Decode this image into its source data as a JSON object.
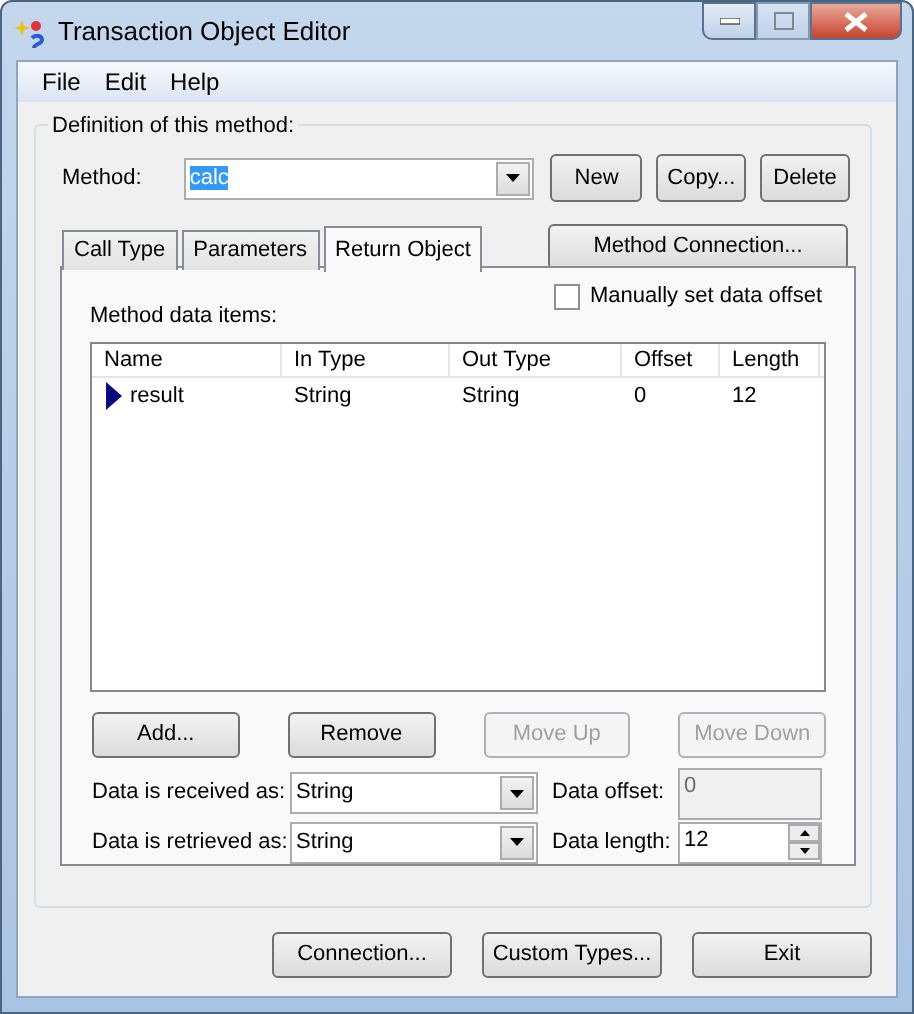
{
  "window": {
    "title": "Transaction Object Editor"
  },
  "menu": [
    {
      "label": "File"
    },
    {
      "label": "Edit"
    },
    {
      "label": "Help"
    }
  ],
  "definition": {
    "title": "Definition of this method:",
    "method": {
      "label": "Method:",
      "value": "calc"
    },
    "buttons": [
      {
        "label": "New",
        "disabled": false
      },
      {
        "label": "Copy...",
        "disabled": false
      },
      {
        "label": "Delete",
        "disabled": false
      }
    ],
    "tabs": [
      {
        "label": "Call Type",
        "selected": false
      },
      {
        "label": "Parameters",
        "selected": false
      },
      {
        "label": "Return Object",
        "selected": true
      }
    ],
    "method_connection": "Method Connection...",
    "data_items_label": "Method data items:",
    "manual_offset": {
      "label": "Manually set data offset",
      "checked": false
    },
    "table": {
      "columns": [
        "Name",
        "In Type",
        "Out Type",
        "Offset",
        "Length"
      ],
      "rows": [
        {
          "cells": [
            "result",
            "String",
            "String",
            "0",
            "12"
          ],
          "current": true
        }
      ]
    },
    "item_buttons": [
      {
        "label": "Add...",
        "disabled": false
      },
      {
        "label": "Remove",
        "disabled": false
      },
      {
        "label": "Move Up",
        "disabled": true
      },
      {
        "label": "Move Down",
        "disabled": true
      }
    ],
    "received": {
      "label": "Data is received as:",
      "value": "String"
    },
    "retrieved": {
      "label": "Data is retrieved as:",
      "value": "String"
    },
    "offset": {
      "label": "Data offset:",
      "value": "0",
      "disabled": true
    },
    "length": {
      "label": "Data length:",
      "value": "12",
      "disabled": false
    }
  },
  "footer_buttons": [
    {
      "label": "Connection..."
    },
    {
      "label": "Custom Types..."
    },
    {
      "label": "Exit"
    }
  ]
}
